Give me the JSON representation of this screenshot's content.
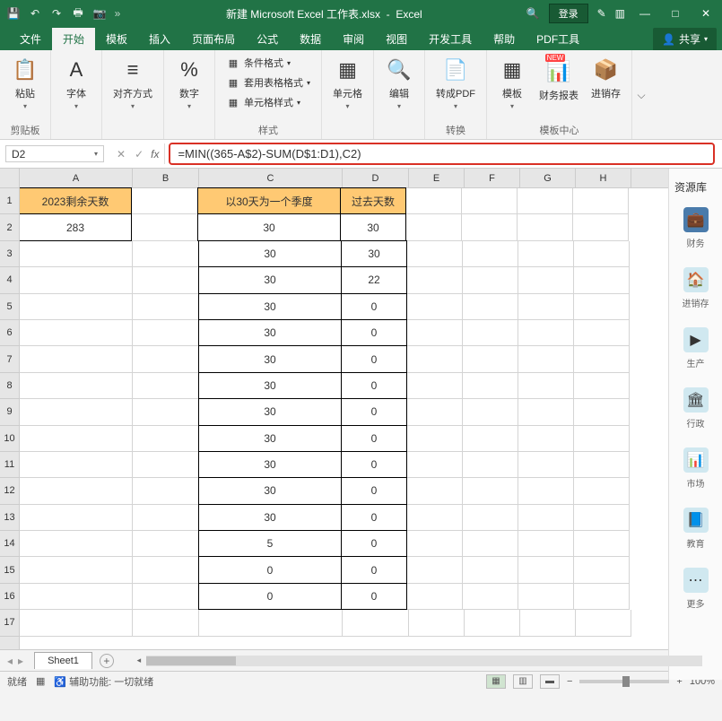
{
  "title": {
    "filename": "新建 Microsoft Excel 工作表.xlsx",
    "appname": "Excel",
    "login": "登录"
  },
  "tabs": {
    "file": "文件",
    "home": "开始",
    "template": "模板",
    "insert": "插入",
    "pagelayout": "页面布局",
    "formulas": "公式",
    "data": "数据",
    "review": "审阅",
    "view": "视图",
    "dev": "开发工具",
    "help": "帮助",
    "pdf": "PDF工具",
    "share": "共享"
  },
  "ribbon": {
    "paste": "粘贴",
    "clipboard": "剪贴板",
    "font": "字体",
    "align": "对齐方式",
    "number": "数字",
    "condformat": "条件格式",
    "tableformat": "套用表格格式",
    "cellstyle": "单元格样式",
    "styles": "样式",
    "cells": "单元格",
    "editing": "编辑",
    "topdf": "转成PDF",
    "convert": "转换",
    "templates": "模板",
    "finance": "财务报表",
    "inventory": "进销存",
    "templatecenter": "模板中心",
    "new": "NEW"
  },
  "formula": {
    "cellref": "D2",
    "value": "=MIN((365-A$2)-SUM(D$1:D1),C2)",
    "fx": "fx"
  },
  "cols": [
    "A",
    "B",
    "C",
    "D",
    "E",
    "F",
    "G",
    "H"
  ],
  "rows": [
    "1",
    "2",
    "3",
    "4",
    "5",
    "6",
    "7",
    "8",
    "9",
    "10",
    "11",
    "12",
    "13",
    "14",
    "15",
    "16",
    "17"
  ],
  "cells": {
    "A1": "2023剩余天数",
    "A2": "283",
    "C1": "以30天为一个季度",
    "D1": "过去天数",
    "C2": "30",
    "D2": "30",
    "C3": "30",
    "D3": "30",
    "C4": "30",
    "D4": "22",
    "C5": "30",
    "D5": "0",
    "C6": "30",
    "D6": "0",
    "C7": "30",
    "D7": "0",
    "C8": "30",
    "D8": "0",
    "C9": "30",
    "D9": "0",
    "C10": "30",
    "D10": "0",
    "C11": "30",
    "D11": "0",
    "C12": "30",
    "D12": "0",
    "C13": "30",
    "D13": "0",
    "C14": "5",
    "D14": "0",
    "C15": "0",
    "D15": "0",
    "C16": "0",
    "D16": "0"
  },
  "respane": {
    "title": "资源库",
    "items": [
      "财务",
      "进销存",
      "生产",
      "行政",
      "市场",
      "教育",
      "更多"
    ]
  },
  "sheet": {
    "name": "Sheet1"
  },
  "status": {
    "ready": "就绪",
    "access": "辅助功能: 一切就绪",
    "zoom": "100%"
  }
}
